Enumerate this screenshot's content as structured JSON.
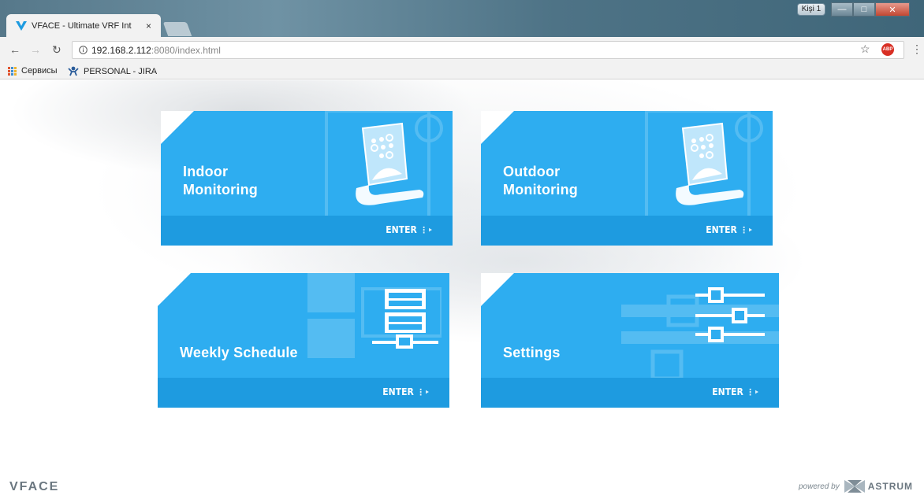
{
  "browser": {
    "tab_title": "VFACE - Ultimate VRF Int",
    "tab_close": "×",
    "profile_button": "Kişi 1",
    "url_host": "192.168.2.112",
    "url_rest": ":8080/index.html",
    "adblock_label": "ABP",
    "bookmarks": [
      {
        "label": "Сервисы",
        "icon": "apps-grid-icon"
      },
      {
        "label": "PERSONAL - JIRA",
        "icon": "jira-icon"
      }
    ]
  },
  "tiles": [
    {
      "label": "Indoor\nMonitoring",
      "enter": "ENTER",
      "icon": "indoor-unit-icon"
    },
    {
      "label": "Outdoor\nMonitoring",
      "enter": "ENTER",
      "icon": "outdoor-unit-icon"
    },
    {
      "label": "Weekly Schedule",
      "enter": "ENTER",
      "icon": "schedule-icon"
    },
    {
      "label": "Settings",
      "enter": "ENTER",
      "icon": "sliders-icon"
    }
  ],
  "footer": {
    "brand": "VFACE",
    "powered_by": "powered by",
    "company": "ASTRUM"
  },
  "colors": {
    "tile": "#2eadf0",
    "tile_footer": "#1e9be0"
  }
}
